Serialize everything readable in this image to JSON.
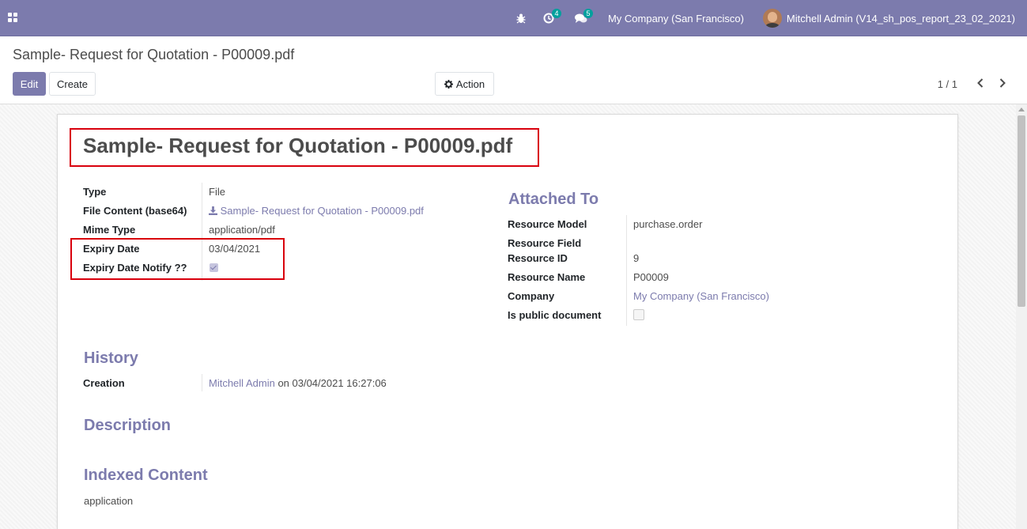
{
  "navbar": {
    "activity_count": "4",
    "message_count": "5",
    "company": "My Company (San Francisco)",
    "user": "Mitchell Admin (V14_sh_pos_report_23_02_2021)",
    "bg_color": "#7c7bad"
  },
  "control_panel": {
    "breadcrumb": "Sample- Request for Quotation - P00009.pdf",
    "edit_label": "Edit",
    "create_label": "Create",
    "action_label": "Action",
    "pager": "1 / 1"
  },
  "record": {
    "title": "Sample- Request for Quotation - P00009.pdf",
    "fields": {
      "type": {
        "label": "Type",
        "value": "File"
      },
      "file_content": {
        "label": "File Content (base64)",
        "value": "Sample- Request for Quotation - P00009.pdf"
      },
      "mime_type": {
        "label": "Mime Type",
        "value": "application/pdf"
      },
      "expiry_date": {
        "label": "Expiry Date",
        "value": "03/04/2021"
      },
      "expiry_notify": {
        "label": "Expiry Date Notify ??",
        "checked": true
      }
    },
    "attached_to": {
      "title": "Attached To",
      "resource_model": {
        "label": "Resource Model",
        "value": "purchase.order"
      },
      "resource_field": {
        "label": "Resource Field",
        "value": ""
      },
      "resource_id": {
        "label": "Resource ID",
        "value": "9"
      },
      "resource_name": {
        "label": "Resource Name",
        "value": "P00009"
      },
      "company": {
        "label": "Company",
        "value": "My Company (San Francisco)"
      },
      "is_public": {
        "label": "Is public document",
        "checked": false
      }
    },
    "history": {
      "title": "History",
      "creation_label": "Creation",
      "creator": "Mitchell Admin",
      "on_text": "on 03/04/2021 16:27:06"
    },
    "description": {
      "title": "Description"
    },
    "indexed_content": {
      "title": "Indexed Content",
      "value": "application"
    }
  },
  "colors": {
    "accent": "#7c7bad",
    "highlight": "#d9000d"
  }
}
